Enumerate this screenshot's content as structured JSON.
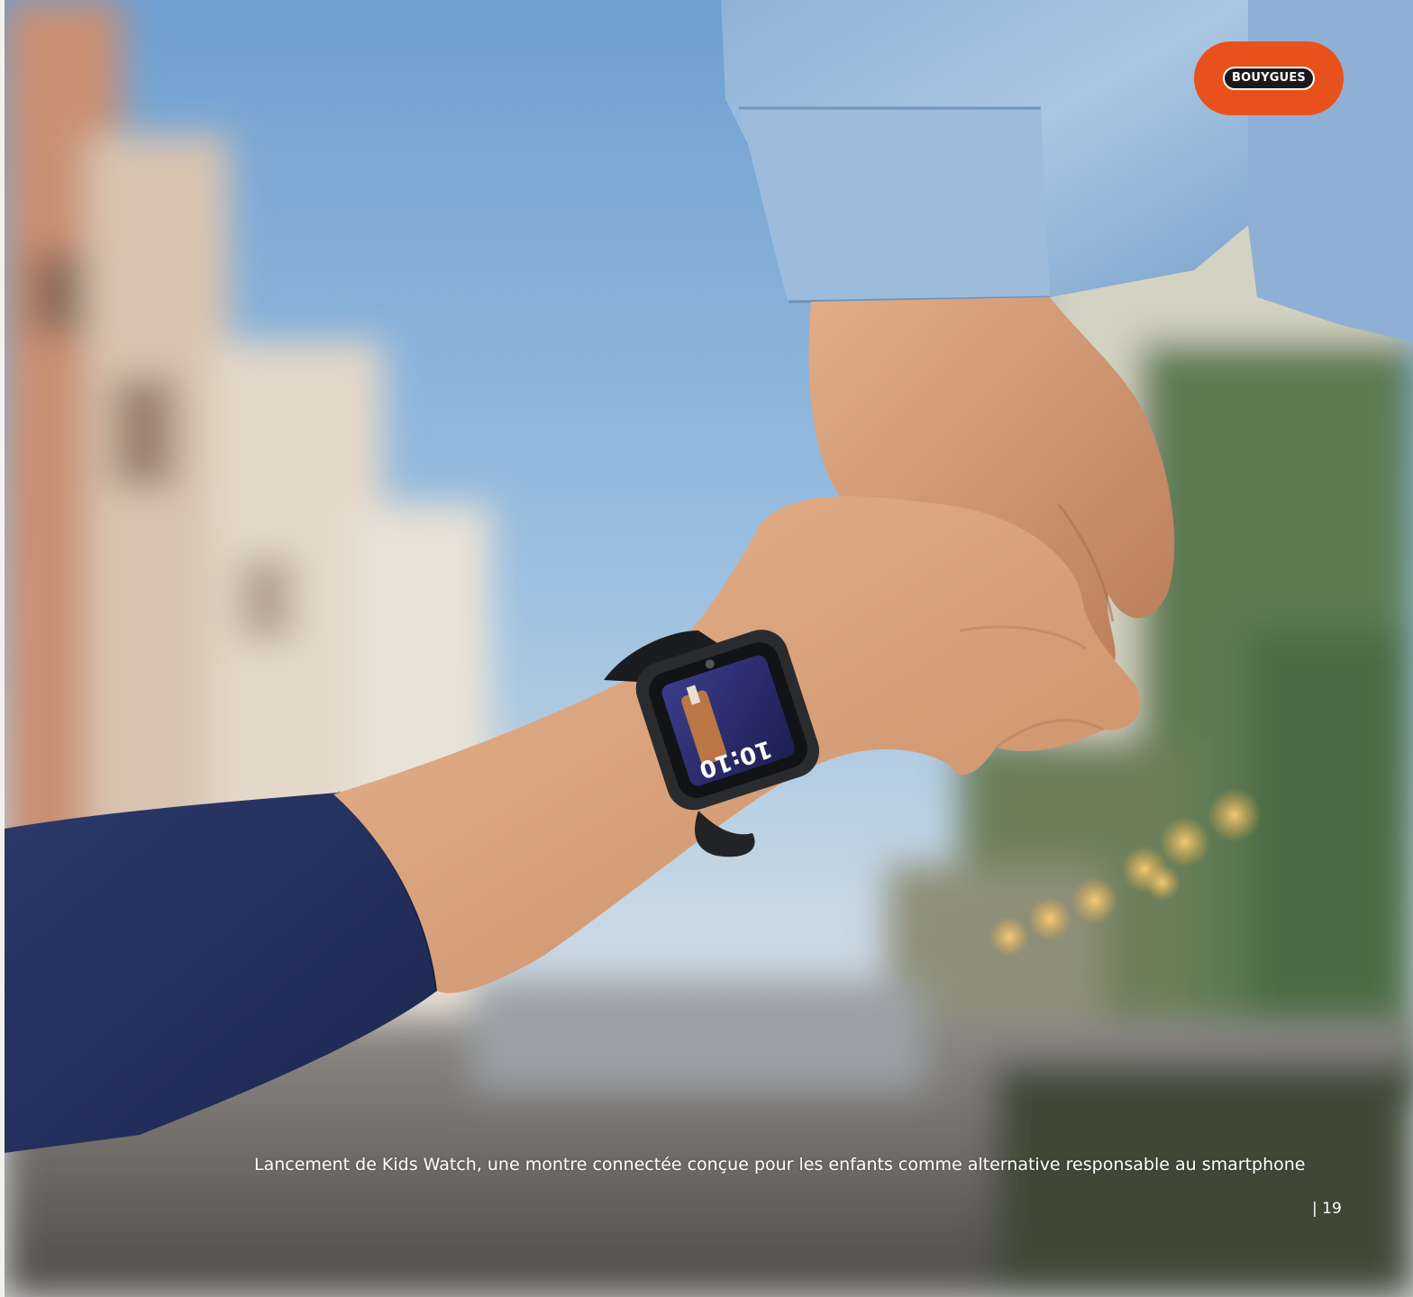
{
  "brand": {
    "logo_text": "BOUYGUES",
    "badge_color": "#e8511b"
  },
  "photo": {
    "watch_time": "10:10"
  },
  "caption": "Lancement de Kids Watch, une montre connectée conçue pour les enfants comme alternative responsable au smartphone",
  "page_number": "| 19"
}
